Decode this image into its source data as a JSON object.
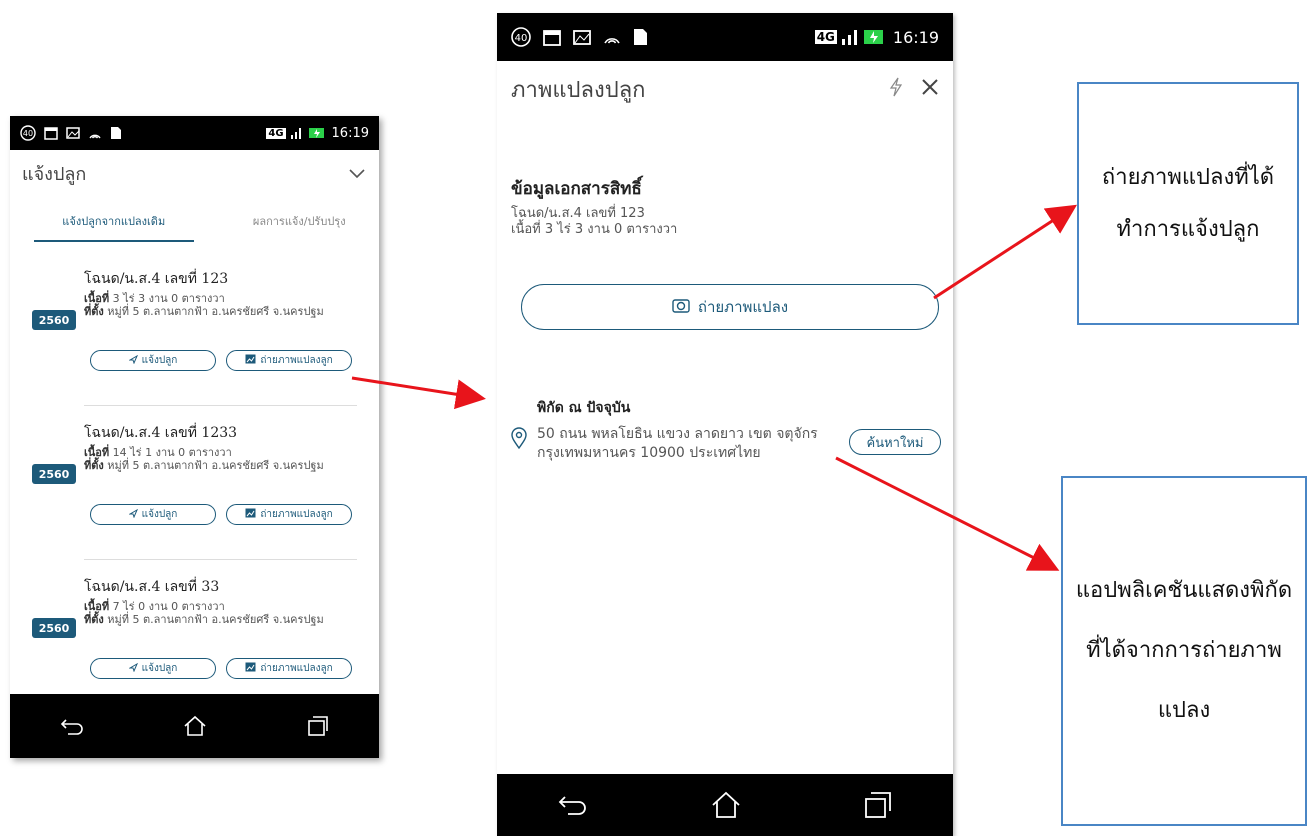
{
  "phone1": {
    "status": {
      "time": "16:19",
      "network": "4G",
      "notif_badge": "40"
    },
    "header": {
      "title": "แจ้งปลูก",
      "collapse_icon": "chevron-down-icon"
    },
    "tabs": [
      {
        "label": "แจ้งปลูกจากแปลงเดิม",
        "active": true
      },
      {
        "label": "ผลการแจ้ง/ปรับปรุง",
        "active": false
      }
    ],
    "cards": [
      {
        "title": "โฉนด/น.ส.4 เลขที่ 123",
        "area_label": "เนื้อที่",
        "area": "3 ไร่ 3 งาน 0 ตารางวา",
        "loc_label": "ที่ตั้ง",
        "location": "หมู่ที่ 5 ต.ลานตากฟ้า อ.นครชัยศรี จ.นครปฐม",
        "year": "2560",
        "btn_report": "แจ้งปลูก",
        "btn_photo": "ถ่ายภาพแปลงลูก"
      },
      {
        "title": "โฉนด/น.ส.4 เลขที่ 1233",
        "area_label": "เนื้อที่",
        "area": "14 ไร่ 1 งาน 0 ตารางวา",
        "loc_label": "ที่ตั้ง",
        "location": "หมู่ที่ 5 ต.ลานตากฟ้า อ.นครชัยศรี จ.นครปฐม",
        "year": "2560",
        "btn_report": "แจ้งปลูก",
        "btn_photo": "ถ่ายภาพแปลงลูก"
      },
      {
        "title": "โฉนด/น.ส.4 เลขที่ 33",
        "area_label": "เนื้อที่",
        "area": "7 ไร่ 0 งาน 0 ตารางวา",
        "loc_label": "ที่ตั้ง",
        "location": "หมู่ที่ 5 ต.ลานตากฟ้า อ.นครชัยศรี จ.นครปฐม",
        "year": "2560",
        "btn_report": "แจ้งปลูก",
        "btn_photo": "ถ่ายภาพแปลงลูก"
      }
    ]
  },
  "phone2": {
    "status": {
      "time": "16:19",
      "network": "4G",
      "notif_badge": "40"
    },
    "header": {
      "title": "ภาพแปลงปลูก",
      "flash_icon": "flash-icon",
      "close_icon": "close-icon"
    },
    "doc": {
      "title": "ข้อมูลเอกสารสิทธิ์",
      "deed": "โฉนด/น.ส.4 เลขที่ 123",
      "area": "เนื้อที่ 3 ไร่ 3 งาน 0 ตารางวา"
    },
    "photo_button": "ถ่ายภาพแปลง",
    "coord": {
      "title": "พิกัด ณ ปัจจุบัน",
      "address": "50 ถนน พหลโยธิน แขวง ลาดยาว เขต จตุจักร กรุงเทพมหานคร 10900 ประเทศไทย",
      "search_again": "ค้นหาใหม่"
    }
  },
  "callouts": {
    "one": "ถ่ายภาพแปลงที่ได้ทำการแจ้งปลูก",
    "two": "แอปพลิเคชันแสดงพิกัดที่ได้จากการถ่ายภาพแปลง"
  },
  "colors": {
    "primary": "#1d5a7a",
    "arrow": "#e8141b",
    "callout_border": "#4a86c5"
  }
}
